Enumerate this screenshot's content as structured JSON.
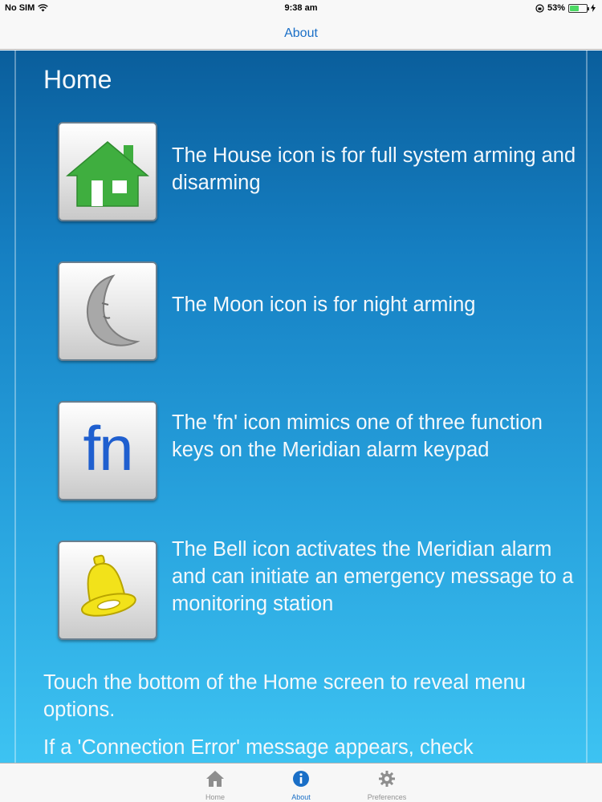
{
  "status_bar": {
    "carrier": "No SIM",
    "time": "9:38 am",
    "battery_percent": "53%",
    "battery_level": 0.53
  },
  "nav": {
    "title": "About"
  },
  "page": {
    "heading": "Home",
    "items": [
      {
        "icon": "house-icon",
        "text": "The House icon is for full system arming and disarming"
      },
      {
        "icon": "moon-icon",
        "text": "The Moon icon is for night arming"
      },
      {
        "icon": "fn-icon",
        "icon_text": "fn",
        "text": "The 'fn' icon mimics one of three function keys on the Meridian alarm keypad"
      },
      {
        "icon": "bell-icon",
        "text": "The Bell icon activates the Meridian alarm and can initiate an emergency message to a monitoring station"
      }
    ],
    "paragraphs": [
      "Touch the bottom of the Home screen to reveal menu options.",
      "If a 'Connection Error' message appears, check"
    ]
  },
  "tabs": [
    {
      "label": "Home",
      "icon": "home-icon",
      "active": false
    },
    {
      "label": "About",
      "icon": "info-icon",
      "active": true
    },
    {
      "label": "Preferences",
      "icon": "gear-icon",
      "active": false
    }
  ],
  "colors": {
    "accent": "#1a6fc7",
    "house_green": "#3fae3f",
    "fn_blue": "#1f5fcf",
    "bell_yellow": "#f2e21a"
  }
}
